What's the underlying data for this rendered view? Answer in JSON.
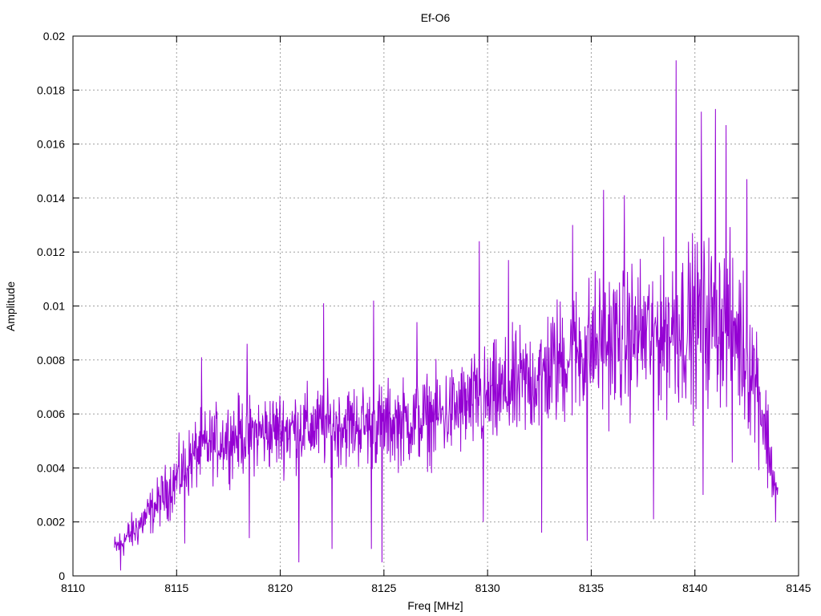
{
  "chart_data": {
    "type": "line",
    "title": "Ef-O6",
    "xlabel": "Freq [MHz]",
    "ylabel": "Amplitude",
    "xlim": [
      8110,
      8145
    ],
    "ylim": [
      0,
      0.02
    ],
    "x_ticks": [
      8110,
      8115,
      8120,
      8125,
      8130,
      8135,
      8140,
      8145
    ],
    "y_ticks": [
      0,
      0.002,
      0.004,
      0.006,
      0.008,
      0.01,
      0.012,
      0.014,
      0.016,
      0.018,
      0.02
    ],
    "x_tick_labels": [
      "8110",
      "8115",
      "8120",
      "8125",
      "8130",
      "8135",
      "8140",
      "8145"
    ],
    "y_tick_labels": [
      "0",
      "0.002",
      "0.004",
      "0.006",
      "0.008",
      "0.01",
      "0.012",
      "0.014",
      "0.016",
      "0.018",
      "0.02"
    ],
    "grid": true,
    "line_color": "#9400D3",
    "series": [
      {
        "x_start": 8112.0,
        "x_end": 8144.0,
        "envelope": {
          "x": [
            8112.0,
            8113.0,
            8114.0,
            8115.0,
            8116.0,
            8117.0,
            8118.0,
            8119.0,
            8120.0,
            8121.0,
            8122.0,
            8123.0,
            8124.0,
            8125.0,
            8126.0,
            8127.0,
            8128.0,
            8129.0,
            8130.0,
            8131.0,
            8132.0,
            8133.0,
            8134.0,
            8135.0,
            8136.0,
            8137.0,
            8138.0,
            8139.0,
            8140.0,
            8141.0,
            8142.0,
            8143.0,
            8143.5,
            8144.0
          ],
          "mean": [
            0.001,
            0.0017,
            0.0026,
            0.0036,
            0.0046,
            0.005,
            0.0052,
            0.0053,
            0.0054,
            0.0055,
            0.0055,
            0.0056,
            0.0056,
            0.0056,
            0.0057,
            0.0058,
            0.006,
            0.0063,
            0.0065,
            0.0068,
            0.0072,
            0.0077,
            0.0082,
            0.0085,
            0.0087,
            0.0089,
            0.009,
            0.0092,
            0.0094,
            0.0096,
            0.0091,
            0.0072,
            0.005,
            0.0027
          ],
          "spread": [
            0.0007,
            0.001,
            0.0012,
            0.0016,
            0.0018,
            0.0018,
            0.0019,
            0.0019,
            0.002,
            0.002,
            0.002,
            0.002,
            0.0021,
            0.0021,
            0.0021,
            0.0022,
            0.0023,
            0.0024,
            0.0026,
            0.0027,
            0.0029,
            0.0031,
            0.0033,
            0.0035,
            0.0036,
            0.0037,
            0.0038,
            0.004,
            0.0041,
            0.0041,
            0.004,
            0.0033,
            0.0024,
            0.0012
          ]
        },
        "peaks": [
          {
            "x": 8116.2,
            "y": 0.0081
          },
          {
            "x": 8118.4,
            "y": 0.0086
          },
          {
            "x": 8122.1,
            "y": 0.0101
          },
          {
            "x": 8124.5,
            "y": 0.0102
          },
          {
            "x": 8126.6,
            "y": 0.0094
          },
          {
            "x": 8129.6,
            "y": 0.0124
          },
          {
            "x": 8131.0,
            "y": 0.0117
          },
          {
            "x": 8134.1,
            "y": 0.013
          },
          {
            "x": 8135.6,
            "y": 0.0143
          },
          {
            "x": 8136.6,
            "y": 0.0141
          },
          {
            "x": 8139.1,
            "y": 0.0191
          },
          {
            "x": 8140.3,
            "y": 0.0172
          },
          {
            "x": 8141.0,
            "y": 0.0173
          },
          {
            "x": 8141.5,
            "y": 0.0167
          },
          {
            "x": 8142.5,
            "y": 0.0147
          }
        ],
        "dips": [
          {
            "x": 8112.3,
            "y": 0.0002
          },
          {
            "x": 8115.4,
            "y": 0.0012
          },
          {
            "x": 8118.5,
            "y": 0.0014
          },
          {
            "x": 8120.9,
            "y": 0.0005
          },
          {
            "x": 8122.5,
            "y": 0.001
          },
          {
            "x": 8124.4,
            "y": 0.001
          },
          {
            "x": 8124.9,
            "y": 0.0005
          },
          {
            "x": 8129.8,
            "y": 0.002
          },
          {
            "x": 8132.6,
            "y": 0.0016
          },
          {
            "x": 8134.8,
            "y": 0.0013
          },
          {
            "x": 8138.0,
            "y": 0.0021
          },
          {
            "x": 8140.4,
            "y": 0.003
          },
          {
            "x": 8141.8,
            "y": 0.0042
          },
          {
            "x": 8143.9,
            "y": 0.002
          }
        ]
      }
    ]
  }
}
